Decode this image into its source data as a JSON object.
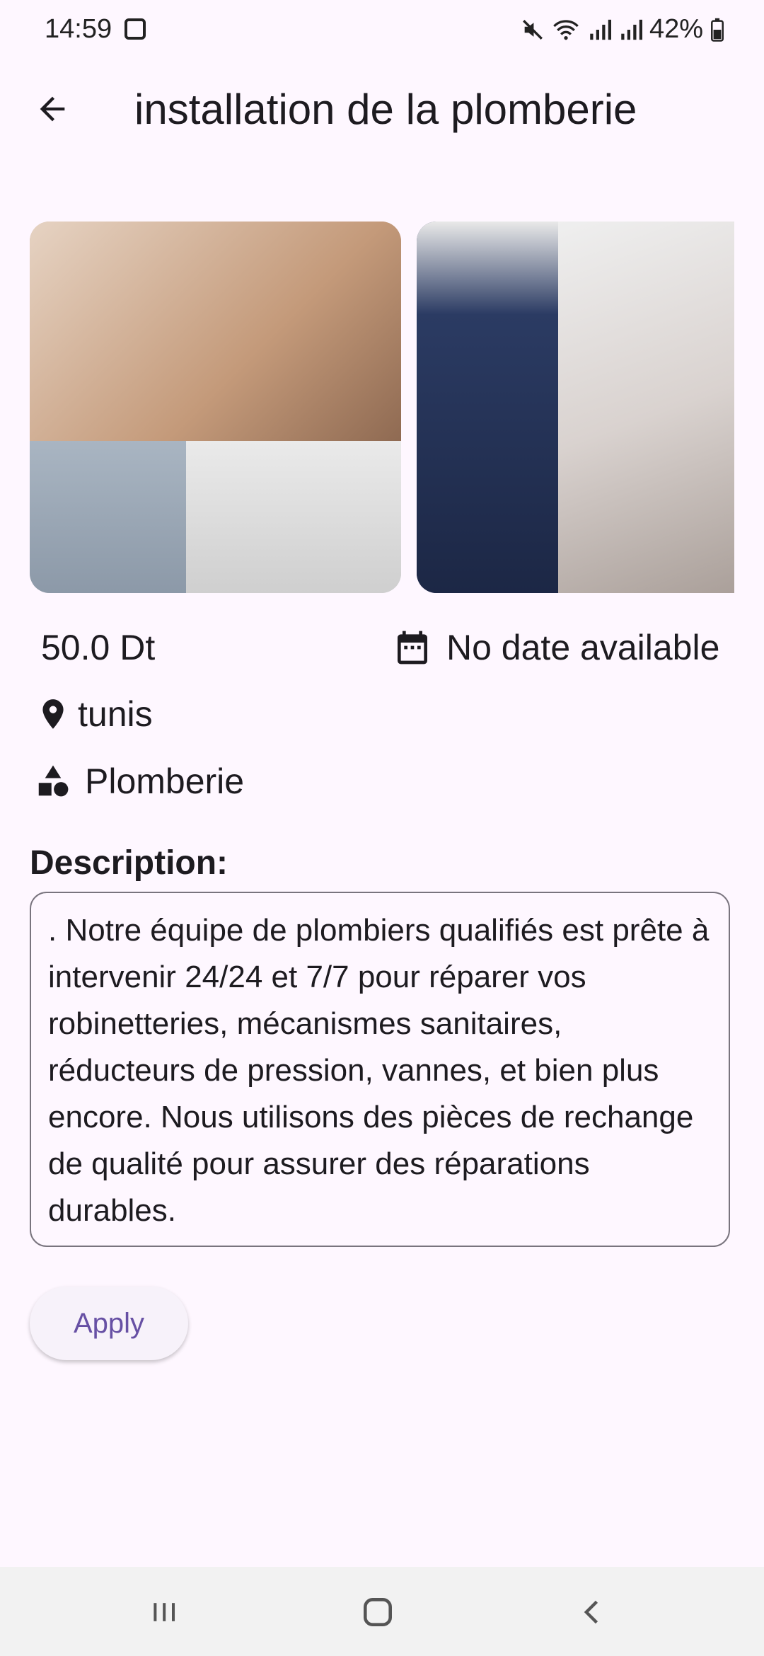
{
  "status_bar": {
    "time": "14:59",
    "battery": "42%"
  },
  "app_bar": {
    "title": "installation de la plomberie"
  },
  "listing": {
    "price": "50.0 Dt",
    "date": "No date available",
    "location": "tunis",
    "category": "Plomberie",
    "description_label": "Description:",
    "description": ". Notre équipe de plombiers qualifiés est prête à intervenir 24/24 et 7/7 pour réparer vos robinetteries, mécanismes sanitaires, réducteurs de pression, vannes, et bien plus encore. Nous utilisons des pièces de rechange de qualité pour assurer des réparations durables."
  },
  "actions": {
    "apply_label": "Apply"
  },
  "colors": {
    "background": "#fef7ff",
    "accent": "#6750a4",
    "outline": "#79747e"
  },
  "icons": [
    "arrow-back-icon",
    "calendar-icon",
    "location-pin-icon",
    "category-icon",
    "mute-icon",
    "wifi-icon",
    "signal-icon",
    "battery-icon",
    "recents-icon",
    "home-icon",
    "nav-back-icon"
  ]
}
